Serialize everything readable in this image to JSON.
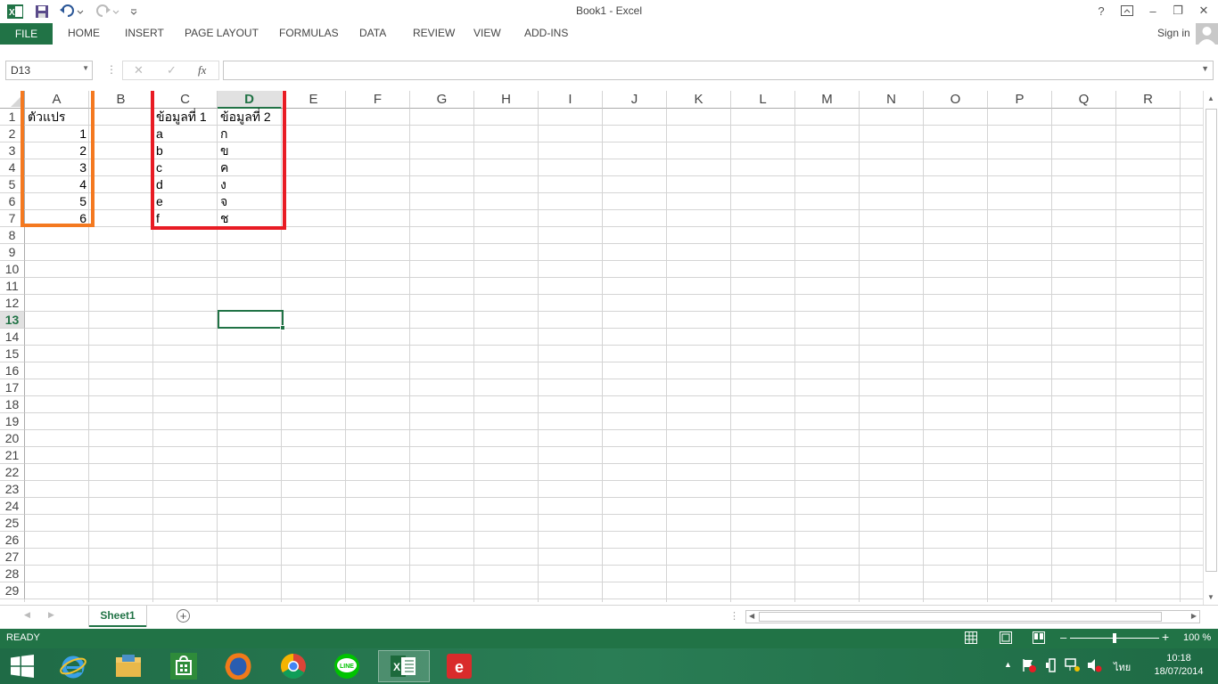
{
  "window": {
    "title": "Book1 - Excel",
    "help": "?",
    "minimize": "–",
    "restore": "❐",
    "close": "✕"
  },
  "ribbon": {
    "file": "FILE",
    "tabs": [
      "HOME",
      "INSERT",
      "PAGE LAYOUT",
      "FORMULAS",
      "DATA",
      "REVIEW",
      "VIEW",
      "ADD-INS"
    ],
    "signin": "Sign in"
  },
  "formula_bar": {
    "name_box": "D13",
    "cancel": "✕",
    "enter": "✓",
    "fx": "fx",
    "value": ""
  },
  "grid": {
    "columns": [
      "A",
      "B",
      "C",
      "D",
      "E",
      "F",
      "G",
      "H",
      "I",
      "J",
      "K",
      "L",
      "M",
      "N",
      "O",
      "P",
      "Q",
      "R"
    ],
    "selected_column": "D",
    "selected_row": 13,
    "rows": [
      1,
      2,
      3,
      4,
      5,
      6,
      7,
      8,
      9,
      10,
      11,
      12,
      13,
      14,
      15,
      16,
      17,
      18,
      19,
      20,
      21,
      22,
      23,
      24,
      25,
      26,
      27,
      28,
      29
    ],
    "cells": {
      "A1": "ตัวแปร",
      "A2": "1",
      "A3": "2",
      "A4": "3",
      "A5": "4",
      "A6": "5",
      "A7": "6",
      "C1": "ข้อมูลที่ 1",
      "C2": "a",
      "C3": "b",
      "C4": "c",
      "C5": "d",
      "C6": "e",
      "C7": "f",
      "D1": "ข้อมูลที่ 2",
      "D2": "ก",
      "D3": "ข",
      "D4": "ค",
      "D5": "ง",
      "D6": "จ",
      "D7": "ช"
    },
    "highlight_colors": {
      "orange": "#f47920",
      "red": "#e81c24"
    }
  },
  "sheets": {
    "tabs": [
      "Sheet1"
    ],
    "add": "+"
  },
  "status": {
    "text": "READY",
    "zoom": "100 %",
    "zoom_minus": "–",
    "zoom_plus": "+"
  },
  "taskbar": {
    "time": "10:18",
    "date": "18/07/2014",
    "language": "ไทย",
    "apps": [
      "ie-icon",
      "explorer-icon",
      "store-icon",
      "firefox-icon",
      "chrome-icon",
      "line-icon",
      "excel-icon",
      "evernote-icon"
    ],
    "line_label": "LINE"
  },
  "colors": {
    "excel_green": "#217346",
    "grid_line": "#d4d4d4"
  }
}
